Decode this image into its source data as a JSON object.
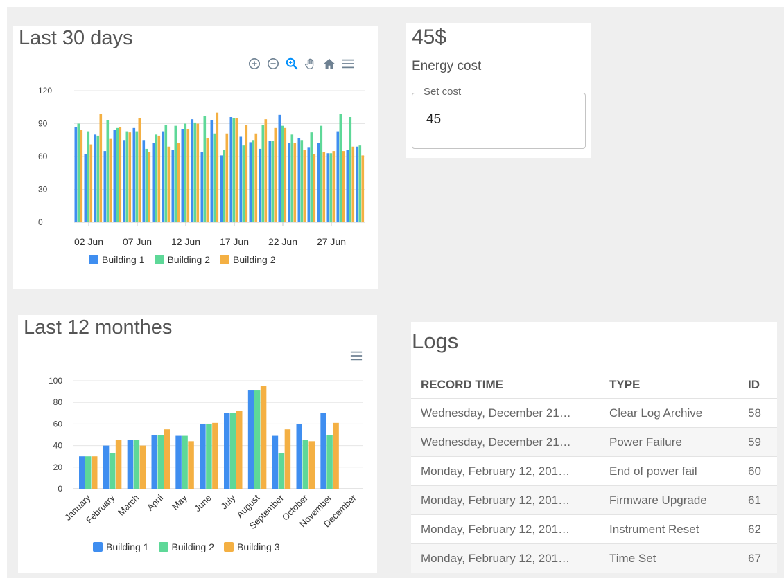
{
  "colors": {
    "building1": "#3f8ef0",
    "building2": "#5ed898",
    "building3": "#f4b043"
  },
  "daily_card": {
    "title": "Last 30 days",
    "toolbar": [
      {
        "name": "zoom-in-icon"
      },
      {
        "name": "zoom-out-icon"
      },
      {
        "name": "zoom-selection-icon"
      },
      {
        "name": "pan-hand-icon"
      },
      {
        "name": "home-reset-icon"
      },
      {
        "name": "menu-icon"
      }
    ],
    "legend": [
      "Building 1",
      "Building 2",
      "Building 2"
    ]
  },
  "monthly_card": {
    "title": "Last 12 monthes",
    "toolbar": [
      {
        "name": "menu-icon"
      }
    ],
    "legend": [
      "Building 1",
      "Building 2",
      "Building 3"
    ]
  },
  "cost_card": {
    "value": "45$",
    "label": "Energy cost",
    "field_label": "Set cost",
    "field_value": "45"
  },
  "logs": {
    "title": "Logs",
    "columns": [
      "RECORD TIME",
      "TYPE",
      "ID"
    ],
    "rows": [
      {
        "time": "Wednesday, December 21…",
        "type": "Clear Log Archive",
        "id": "58"
      },
      {
        "time": "Wednesday, December 21…",
        "type": "Power Failure",
        "id": "59"
      },
      {
        "time": "Monday, February 12, 201…",
        "type": "End of power fail",
        "id": "60"
      },
      {
        "time": "Monday, February 12, 201…",
        "type": "Firmware Upgrade",
        "id": "61"
      },
      {
        "time": "Monday, February 12, 201…",
        "type": "Instrument Reset",
        "id": "62"
      },
      {
        "time": "Monday, February 12, 201…",
        "type": "Time Set",
        "id": "67"
      }
    ]
  },
  "chart_data": [
    {
      "type": "bar",
      "title": "Last 30 days",
      "x_tick_labels": [
        "02 Jun",
        "07 Jun",
        "12 Jun",
        "17 Jun",
        "22 Jun",
        "27 Jun"
      ],
      "y_ticks": [
        0,
        30,
        60,
        90,
        120
      ],
      "ylim": [
        0,
        120
      ],
      "grid": true,
      "legend_position": "bottom",
      "categories": [
        "01 Jun",
        "02 Jun",
        "03 Jun",
        "04 Jun",
        "05 Jun",
        "06 Jun",
        "07 Jun",
        "08 Jun",
        "09 Jun",
        "10 Jun",
        "11 Jun",
        "12 Jun",
        "13 Jun",
        "14 Jun",
        "15 Jun",
        "16 Jun",
        "17 Jun",
        "18 Jun",
        "19 Jun",
        "20 Jun",
        "21 Jun",
        "22 Jun",
        "23 Jun",
        "24 Jun",
        "25 Jun",
        "26 Jun",
        "27 Jun",
        "28 Jun",
        "29 Jun",
        "30 Jun"
      ],
      "series": [
        {
          "name": "Building 1",
          "values": [
            87,
            62,
            80,
            65,
            84,
            75,
            86,
            75,
            72,
            83,
            66,
            85,
            94,
            64,
            93,
            61,
            96,
            78,
            73,
            67,
            74,
            98,
            72,
            77,
            68,
            72,
            63,
            83,
            66,
            69
          ]
        },
        {
          "name": "Building 2",
          "values": [
            90,
            83,
            79,
            93,
            86,
            83,
            83,
            67,
            80,
            89,
            88,
            90,
            91,
            97,
            81,
            66,
            95,
            70,
            75,
            89,
            74,
            88,
            80,
            75,
            82,
            88,
            63,
            99,
            96,
            70
          ]
        },
        {
          "name": "Building 2",
          "values": [
            84,
            71,
            99,
            76,
            87,
            82,
            95,
            64,
            79,
            69,
            72,
            85,
            90,
            77,
            100,
            81,
            95,
            89,
            81,
            94,
            86,
            86,
            72,
            66,
            62,
            64,
            65,
            65,
            69,
            61
          ]
        }
      ]
    },
    {
      "type": "bar",
      "title": "Last 12 monthes",
      "categories": [
        "January",
        "February",
        "March",
        "April",
        "May",
        "June",
        "July",
        "August",
        "September",
        "October",
        "November",
        "December"
      ],
      "y_ticks": [
        0,
        20,
        40,
        60,
        80,
        100
      ],
      "ylim": [
        0,
        100
      ],
      "grid": true,
      "legend_position": "bottom",
      "series": [
        {
          "name": "Building 1",
          "values": [
            30,
            40,
            45,
            50,
            49,
            60,
            70,
            91,
            49,
            60,
            70
          ]
        },
        {
          "name": "Building 2",
          "values": [
            30,
            33,
            45,
            50,
            49,
            60,
            70,
            91,
            33,
            45,
            50
          ]
        },
        {
          "name": "Building 3",
          "values": [
            30,
            45,
            40,
            55,
            44,
            61,
            72,
            95,
            55,
            44,
            61
          ]
        }
      ]
    }
  ]
}
